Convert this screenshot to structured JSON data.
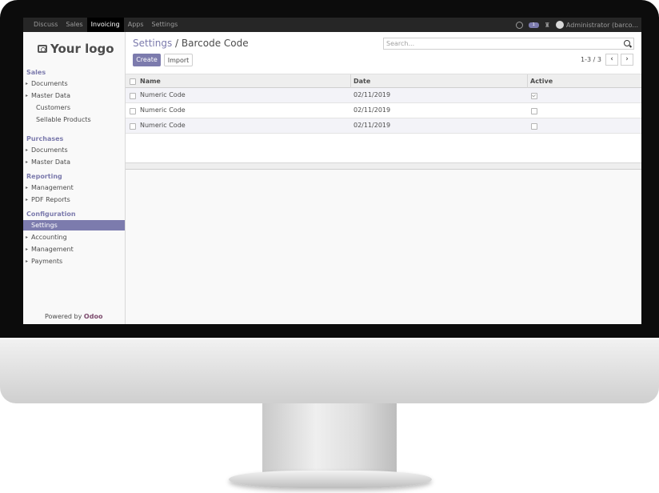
{
  "topbar": {
    "menu": [
      {
        "label": "Discuss",
        "active": false
      },
      {
        "label": "Sales",
        "active": false
      },
      {
        "label": "Invoicing",
        "active": true
      },
      {
        "label": "Apps",
        "active": false
      },
      {
        "label": "Settings",
        "active": false
      }
    ],
    "chat_badge": "1",
    "user_label": "Administrator (barco..."
  },
  "sidebar": {
    "logo_text": "Your logo",
    "sections": {
      "sales": "Sales",
      "purchases": "Purchases",
      "reporting": "Reporting",
      "configuration": "Configuration"
    },
    "items": {
      "sales_documents": "Documents",
      "sales_master_data": "Master Data",
      "customers": "Customers",
      "sellable_products": "Sellable Products",
      "purchases_documents": "Documents",
      "purchases_master_data": "Master Data",
      "management": "Management",
      "pdf_reports": "PDF Reports",
      "settings": "Settings",
      "accounting": "Accounting",
      "config_management": "Management",
      "payments": "Payments"
    },
    "powered_prefix": "Powered by ",
    "powered_brand": "Odoo"
  },
  "control_panel": {
    "breadcrumb_parent": "Settings",
    "breadcrumb_sep": " / ",
    "breadcrumb_current": "Barcode Code",
    "search_placeholder": "Search...",
    "create_label": "Create",
    "import_label": "Import",
    "pager_text": "1-3 / 3",
    "prev_glyph": "‹",
    "next_glyph": "›"
  },
  "table": {
    "columns": [
      "Name",
      "Date",
      "Active"
    ],
    "rows": [
      {
        "name": "Numeric Code",
        "date": "02/11/2019",
        "active": true
      },
      {
        "name": "Numeric Code",
        "date": "02/11/2019",
        "active": false
      },
      {
        "name": "Numeric Code",
        "date": "02/11/2019",
        "active": false
      }
    ]
  },
  "colors": {
    "accent": "#7c7bad",
    "topbar": "#262626",
    "brand_odoo": "#7c4a6d"
  }
}
